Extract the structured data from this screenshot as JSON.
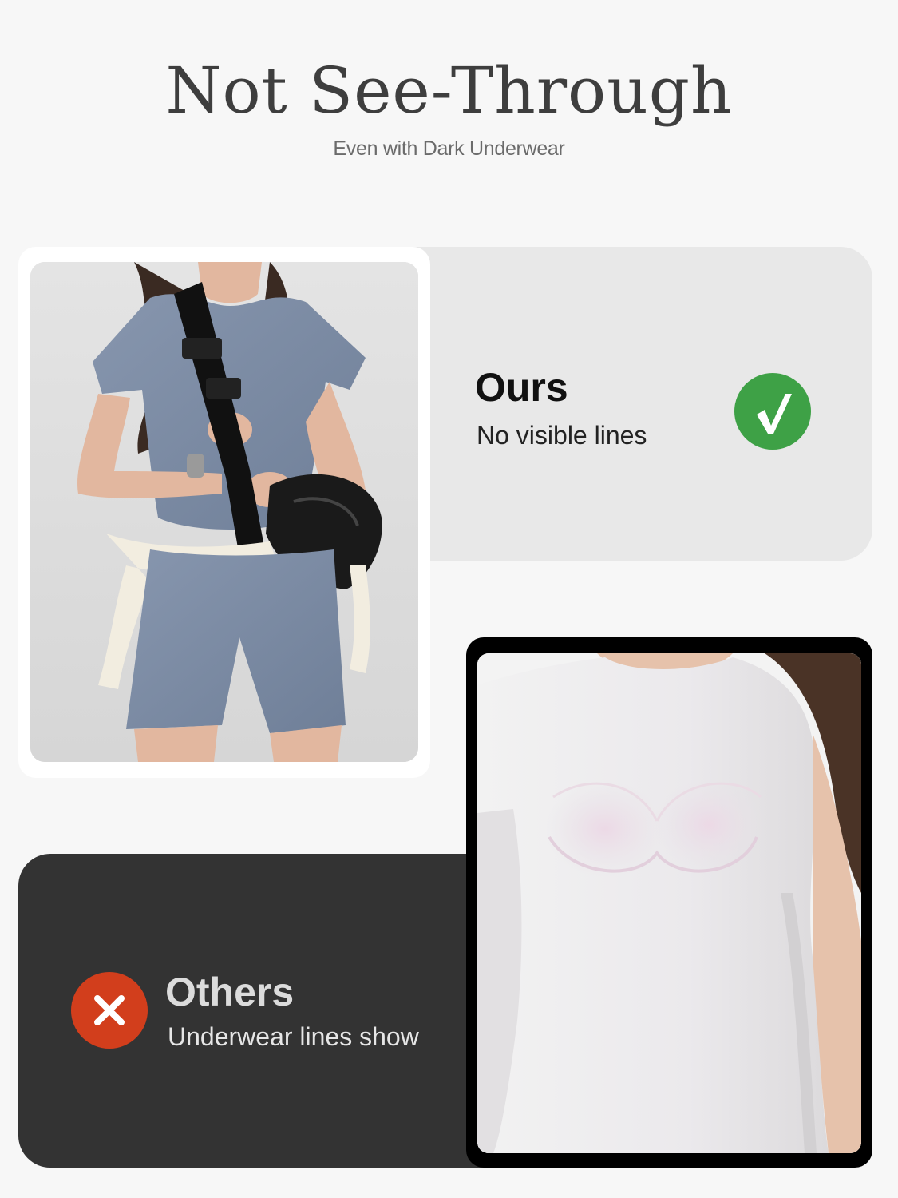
{
  "header": {
    "title": "Not See-Through",
    "subtitle": "Even with Dark Underwear"
  },
  "ours": {
    "label": "Ours",
    "description": "No visible lines",
    "badge_icon": "check-icon",
    "badge_color": "#3ea146",
    "card_color": "#e8e8e8"
  },
  "others": {
    "label": "Others",
    "description": "Underwear lines show",
    "badge_icon": "x-icon",
    "badge_color": "#d23e1c",
    "card_color": "#333333"
  },
  "colors": {
    "background": "#f7f7f7",
    "title": "#3e3e3e",
    "outfit": "#7f8fa8"
  }
}
